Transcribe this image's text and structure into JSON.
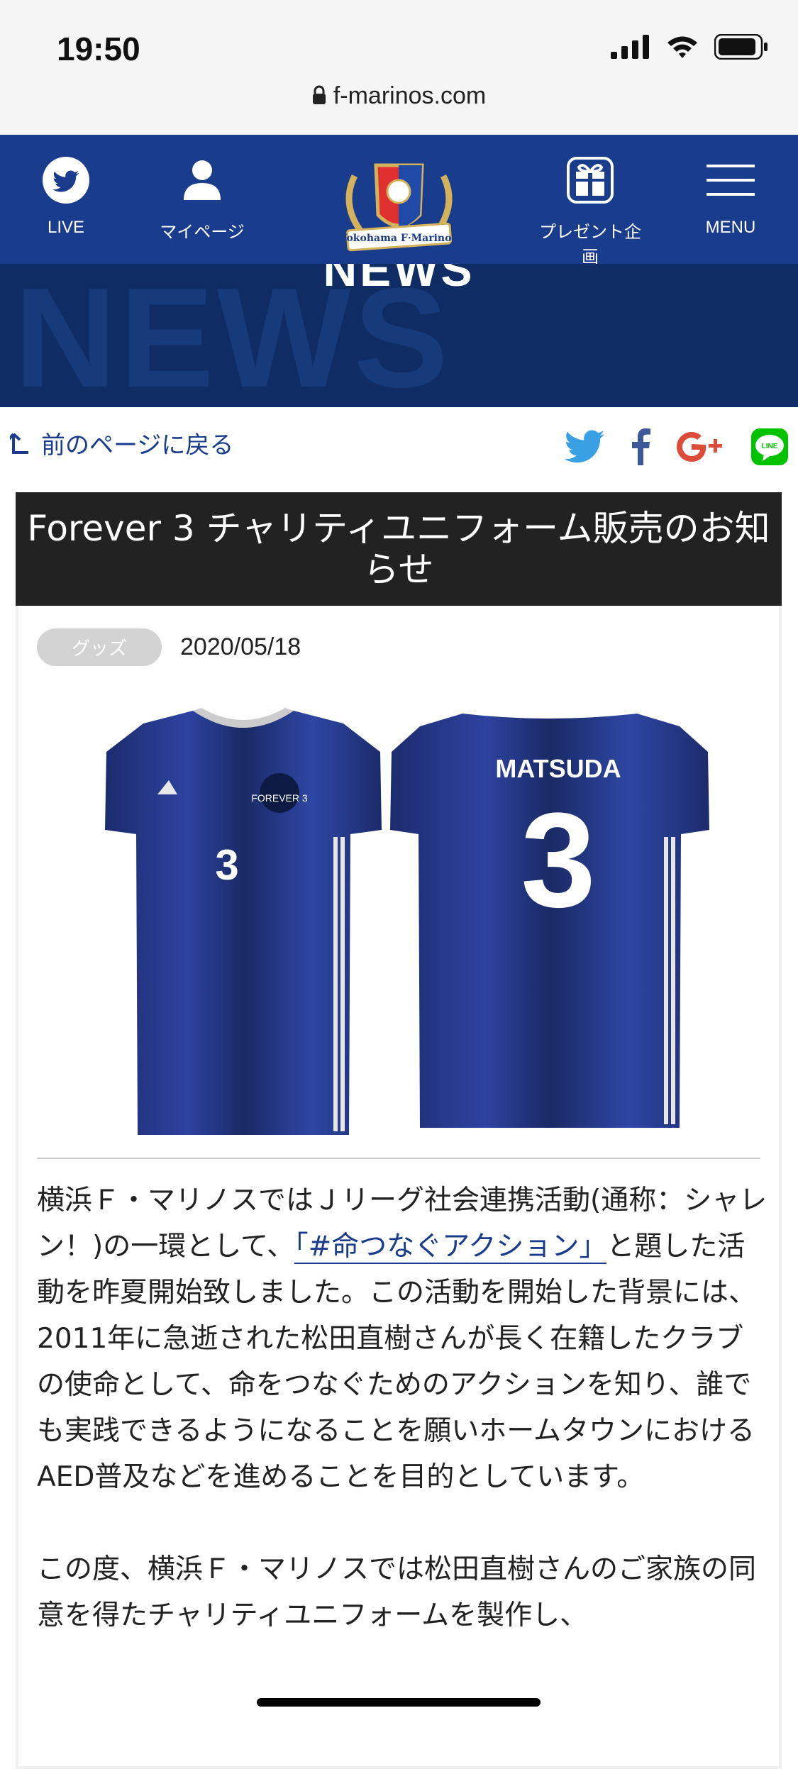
{
  "status_bar": {
    "time": "19:50"
  },
  "url_bar": {
    "domain": "f-marinos.com"
  },
  "header": {
    "live_label": "LIVE",
    "mypage_label": "マイページ",
    "logo_text": "Yokohama F·Marinos",
    "present_label": "プレゼント企画",
    "menu_label": "MENU"
  },
  "banner": {
    "title": "NEWS",
    "bg_text": "NEWS"
  },
  "back": {
    "label": "前のページに戻る"
  },
  "share": {
    "icons": [
      "twitter-icon",
      "facebook-icon",
      "google-plus-icon",
      "line-icon"
    ],
    "line_text": "LINE"
  },
  "article": {
    "title": "Forever 3 チャリティユニフォーム販売のお知らせ",
    "category": "グッズ",
    "date": "2020/05/18",
    "image": {
      "front_number": "3",
      "back_name": "MATSUDA",
      "back_number": "3",
      "crest_text": "FOREVER 3"
    },
    "p1_before": "横浜Ｆ・マリノスではＪリーグ社会連携活動(通称：シャレン！)の一環として、",
    "p1_link": "「#命つなぐアクション」",
    "p1_after": "と題した活動を昨夏開始致しました。この活動を開始した背景には、2011年に急逝された松田直樹さんが長く在籍したクラブの使命として、命をつなぐためのアクションを知り、誰でも実践できるようになることを願いホームタウンにおけるAED普及などを進めることを目的としています。",
    "p2": "この度、横浜Ｆ・マリノスでは松田直樹さんのご家族の同意を得たチャリティユニフォームを製作し、"
  },
  "colors": {
    "brand_blue": "#1a3c8c",
    "banner_navy": "#0f2c64",
    "title_bg": "#222222"
  }
}
